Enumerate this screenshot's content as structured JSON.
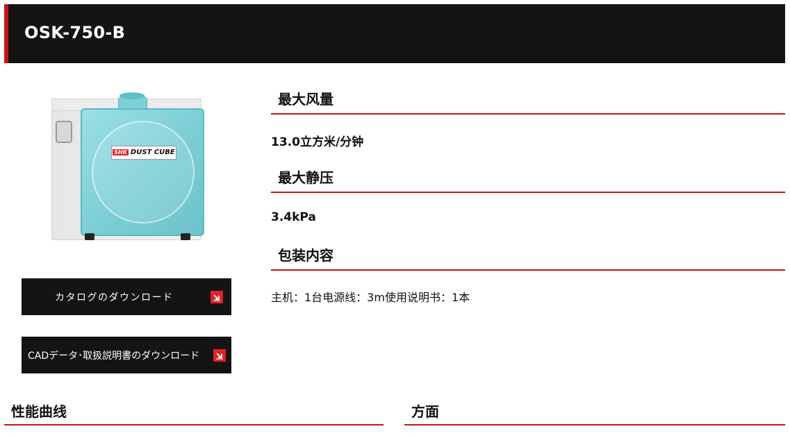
{
  "header": {
    "title": "OSK-750-B"
  },
  "product_image": {
    "label_logo": "SHK",
    "label_text": "DUST CUBE",
    "accent": "#7ecfd6"
  },
  "buttons": {
    "catalog_download": "カタログのダウンロード",
    "cad_download": "CADデータ･取扱説明書のダウンロード",
    "icon": "download-arrow-icon",
    "icon_color": "#e0212a"
  },
  "specs": [
    {
      "label": "最大风量",
      "value": "13.0立方米/分钟"
    },
    {
      "label": "最大静压",
      "value": "3.4kPa"
    },
    {
      "label": "包装内容",
      "value": "主机：1台电源线：3m使用说明书：1本"
    }
  ],
  "sections": {
    "performance_curve": "性能曲线",
    "dimensions": "方面"
  },
  "colors": {
    "header_bg": "#141414",
    "accent_red": "#c4141c"
  }
}
